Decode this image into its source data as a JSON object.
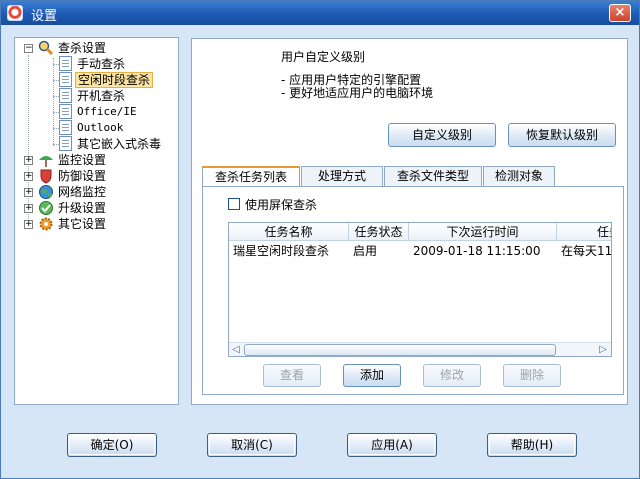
{
  "window": {
    "title": "设置",
    "close_glyph": "×"
  },
  "tree": {
    "root": {
      "label": "查杀设置",
      "expander": "−",
      "icon": "magnifier-icon"
    },
    "children": [
      {
        "label": "手动查杀",
        "style": "normal"
      },
      {
        "label": "空闲时段查杀",
        "style": "selected"
      },
      {
        "label": "开机查杀",
        "style": "normal"
      },
      {
        "label": "Office/IE",
        "style": "mono"
      },
      {
        "label": "Outlook",
        "style": "mono"
      },
      {
        "label": "其它嵌入式杀毒",
        "style": "normal"
      }
    ],
    "others": [
      {
        "label": "监控设置",
        "expander": "+",
        "icon": "umbrella-icon"
      },
      {
        "label": "防御设置",
        "expander": "+",
        "icon": "shield-icon"
      },
      {
        "label": "网络监控",
        "expander": "+",
        "icon": "globe-icon"
      },
      {
        "label": "升级设置",
        "expander": "+",
        "icon": "update-icon"
      },
      {
        "label": "其它设置",
        "expander": "+",
        "icon": "gear-icon"
      }
    ]
  },
  "main": {
    "heading": "用户自定义级别",
    "bullets": [
      "- 应用用户特定的引擎配置",
      "- 更好地适应用户的电脑环境"
    ],
    "custom_level_button": "自定义级别",
    "restore_default_button": "恢复默认级别",
    "tabs": [
      "查杀任务列表",
      "处理方式",
      "查杀文件类型",
      "检测对象"
    ],
    "screensaver_checkbox": {
      "label": "使用屏保查杀",
      "checked": false
    },
    "table": {
      "columns": [
        "任务名称",
        "任务状态",
        "下次运行时间",
        "任务"
      ],
      "rows": [
        {
          "name": "瑞星空闲时段查杀",
          "status": "启用",
          "next_run": "2009-01-18 11:15:00",
          "task": "在每天11"
        }
      ]
    },
    "scroll_left": "◁",
    "scroll_right": "▷",
    "actions": {
      "view": "查看",
      "add": "添加",
      "modify": "修改",
      "delete": "删除"
    }
  },
  "footer": {
    "ok": "确定(O)",
    "cancel": "取消(C)",
    "apply": "应用(A)",
    "help": "帮助(H)"
  },
  "colors": {
    "titlebar": "#1e5ab4",
    "window_bg": "#d6e6f7",
    "selection": "#fbe3a2",
    "active_tab_accent": "#e59a33"
  }
}
